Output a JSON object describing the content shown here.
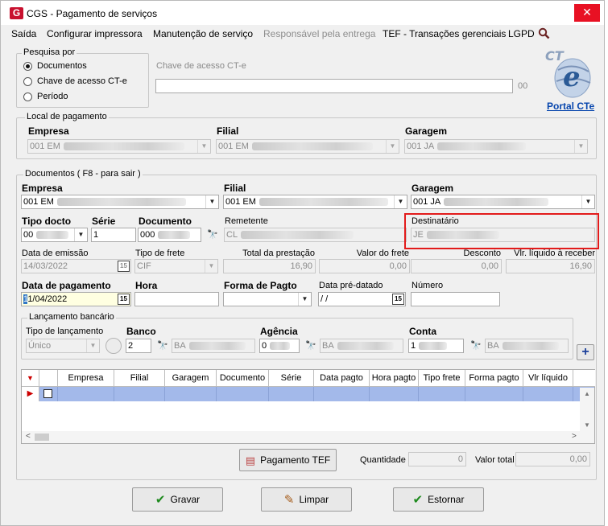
{
  "window": {
    "title": "CGS - Pagamento de serviços",
    "app_logo": "G",
    "close": "✕"
  },
  "menu": {
    "items": [
      "Saída",
      "Configurar impressora",
      "Manutenção de serviço",
      "Responsável pela entrega",
      "TEF - Transações gerenciais",
      "LGPD"
    ],
    "search_icon": "magnifier-icon"
  },
  "pesquisa": {
    "title": "Pesquisa por",
    "options": [
      "Documentos",
      "Chave de acesso CT-e",
      "Período"
    ],
    "selected": "Documentos",
    "chave_label": "Chave de acesso CT-e",
    "chave_value": "",
    "chave_suffix": "00"
  },
  "cte": {
    "logo": "CT e",
    "link": "Portal CTe"
  },
  "local_pagamento": {
    "title": "Local de pagamento",
    "empresa_label": "Empresa",
    "empresa_value": "001 EM",
    "filial_label": "Filial",
    "filial_value": "001 EM",
    "garagem_label": "Garagem",
    "garagem_value": "001 JA"
  },
  "documentos": {
    "title": "Documentos ( F8 - para sair )",
    "empresa_label": "Empresa",
    "empresa_value": "001 EM",
    "filial_label": "Filial",
    "filial_value": "001 EM",
    "garagem_label": "Garagem",
    "garagem_value": "001 JA",
    "tipo_docto_label": "Tipo docto",
    "tipo_docto_value": "00",
    "serie_label": "Série",
    "serie_value": "1",
    "documento_label": "Documento",
    "documento_value": "000",
    "remetente_label": "Remetente",
    "remetente_value": "CL",
    "destinatario_label": "Destinatário",
    "destinatario_value": "JE",
    "data_emissao_label": "Data de emissão",
    "data_emissao_value": "14/03/2022",
    "tipo_frete_label": "Tipo de frete",
    "tipo_frete_value": "CIF",
    "total_prestacao_label": "Total da prestação",
    "total_prestacao_value": "16,90",
    "valor_frete_label": "Valor do frete",
    "valor_frete_value": "0,00",
    "desconto_label": "Desconto",
    "desconto_value": "0,00",
    "vlr_liquido_label": "Vlr. líquido à receber",
    "vlr_liquido_value": "16,90",
    "data_pagamento_label": "Data de pagamento",
    "data_pagamento_caret": "1",
    "data_pagamento_value": "1/04/2022",
    "hora_label": "Hora",
    "hora_value": "",
    "forma_pagto_label": "Forma de Pagto",
    "forma_pagto_value": "",
    "data_pre_label": "Data pré-datado",
    "data_pre_value": " /  /",
    "numero_label": "Número",
    "numero_value": ""
  },
  "lancamento": {
    "title": "Lançamento bancário",
    "tipo_label": "Tipo de lançamento",
    "tipo_value": "Único",
    "banco_label": "Banco",
    "banco_value": "2",
    "banco_nome": "BA",
    "agencia_label": "Agência",
    "agencia_value": "0",
    "agencia_nome": "BA",
    "conta_label": "Conta",
    "conta_value": "1",
    "conta_nome": "BA",
    "add_icon": "+"
  },
  "grid": {
    "columns": [
      "",
      "",
      "Empresa",
      "Filial",
      "Garagem",
      "Documento",
      "Série",
      "Data pagto",
      "Hora pagto",
      "Tipo frete",
      "Forma pagto",
      "Vlr líquido"
    ]
  },
  "footer": {
    "tef_button": "Pagamento TEF",
    "quantidade_label": "Quantidade",
    "quantidade_value": "0",
    "valor_total_label": "Valor total",
    "valor_total_value": "0,00"
  },
  "actions": {
    "gravar": "Gravar",
    "limpar": "Limpar",
    "estornar": "Estornar"
  },
  "colors": {
    "highlight_border": "#e21b1b",
    "grid_selection": "#a3b9ea",
    "link": "#0645ad",
    "close": "#e81123"
  }
}
